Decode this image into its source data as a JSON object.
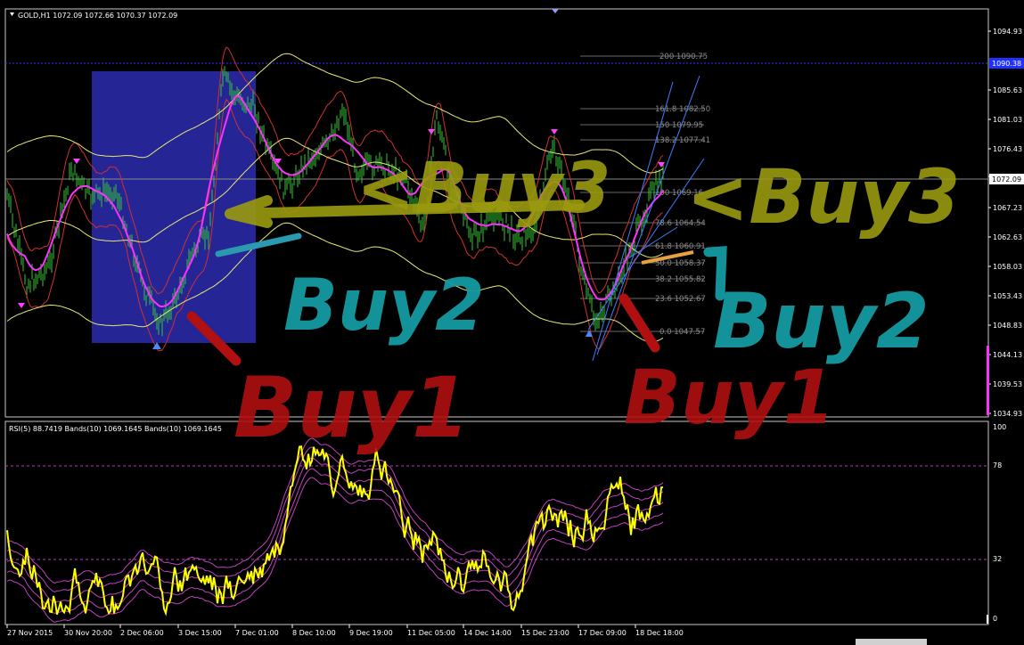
{
  "colors": {
    "background": "#000000",
    "price": "#32c832",
    "bollinger": "#e8e874",
    "envelope": "#d03030",
    "ma": "#ff30ff",
    "rsi": "#ffff00",
    "rsi_bands": "#c040c0",
    "fib": "#9a9a9a",
    "highlight_box": "#2b2bb0",
    "annot_yellow": "#9a9a10",
    "annot_cyan": "#159aa2",
    "annot_red": "#b01010"
  },
  "main_panel": {
    "title": "GOLD,H1  1072.09  1072.66  1070.37  1072.09",
    "price_scale": [
      "1094.93",
      "1085.63",
      "1081.03",
      "1076.43",
      "1072.09",
      "1067.23",
      "1062.63",
      "1058.03",
      "1053.43",
      "1048.83",
      "1044.13",
      "1039.53",
      "1034.93"
    ],
    "current_price": "1072.09",
    "alert_price": "1090.38",
    "fibonacci": [
      "200  1090.75",
      "161.8  1082.50",
      "150  1079.95",
      "138.2  1077.41",
      "100  1069.16",
      "78.6  1064.54",
      "61.8  1060.91",
      "50.0  1058.37",
      "38.2  1055.82",
      "23.6  1052.67",
      "0.0  1047.57"
    ]
  },
  "rsi_panel": {
    "title": "RSI(5) 88.7419  Bands(10) 1069.1645  Bands(10) 1069.1645",
    "scale": [
      "100",
      "78",
      "32",
      "0"
    ]
  },
  "time_axis": [
    "27 Nov 2015",
    "30 Nov 20:00",
    "2 Dec 06:00",
    "3 Dec 15:00",
    "7 Dec 01:00",
    "8 Dec 10:00",
    "9 Dec 19:00",
    "11 Dec 05:00",
    "14 Dec 14:00",
    "15 Dec 23:00",
    "17 Dec 09:00",
    "18 Dec 18:00"
  ],
  "annotations": {
    "buy3_left": "<Buy3",
    "buy3_right": "<Buy3",
    "buy2_left": "Buy2",
    "buy2_right": "Buy2",
    "buy1_left": "Buy1",
    "buy1_right": "Buy1"
  }
}
